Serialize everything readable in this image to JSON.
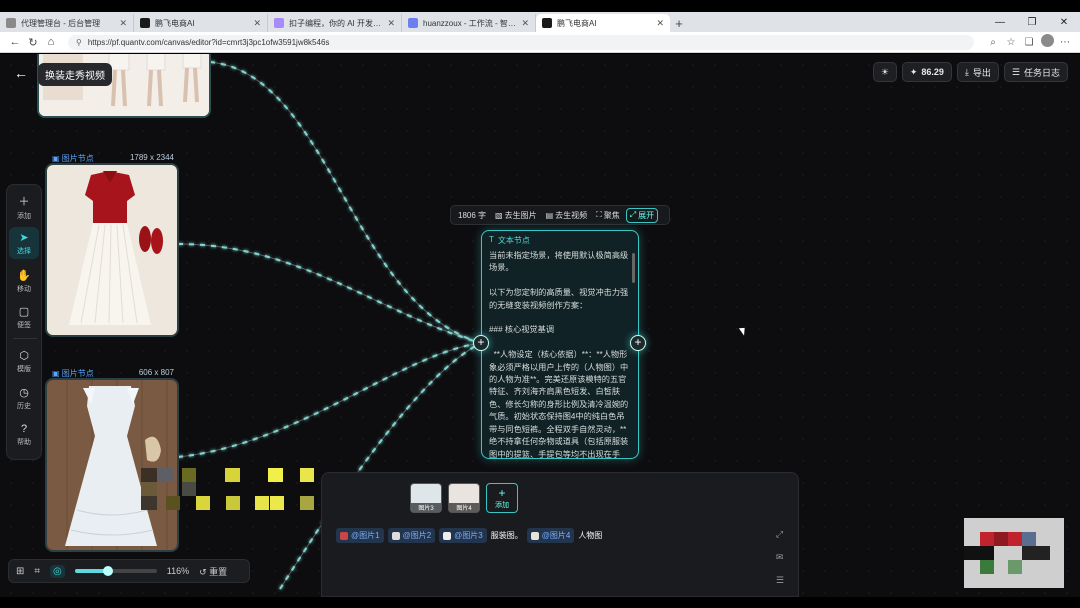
{
  "browser": {
    "tabs": [
      {
        "title": "代理管理台 - 后台管理",
        "fav": "#8a8a8a"
      },
      {
        "title": "鹏飞电商AI",
        "fav": "#1a1a1a"
      },
      {
        "title": "扣子编程，你的 AI 开发伙伴，Vi",
        "fav": "#a78bfa"
      },
      {
        "title": "huanzzoux - 工作流 - 智能体平台",
        "fav": "#6d7ff0"
      },
      {
        "title": "鹏飞电商AI",
        "fav": "#1a1a1a",
        "active": true
      }
    ],
    "url": "https://pf.quantv.com/canvas/editor?id=cmrt3j3pc1ofw3591jw8k546s"
  },
  "header": {
    "title": "换装走秀视频",
    "credits": "86.29",
    "export_label": "导出",
    "tasklog_label": "任务日志"
  },
  "toolbar": {
    "items": [
      {
        "icon": "plus-icon",
        "label": "添加"
      },
      {
        "icon": "cursor-icon",
        "label": "选择",
        "selected": true
      },
      {
        "icon": "hand-icon",
        "label": "移动"
      },
      {
        "icon": "note-icon",
        "label": "便签"
      },
      {
        "icon": "box-icon",
        "label": "模版"
      },
      {
        "icon": "clock-icon",
        "label": "历史"
      },
      {
        "icon": "help-icon",
        "label": "帮助"
      }
    ]
  },
  "image_nodes": [
    {
      "label": "图片节点",
      "size": "1789 x 2344"
    },
    {
      "label": "图片节点",
      "size": "606 x 807"
    }
  ],
  "text_node": {
    "title": "文本节点",
    "word_count": "1806 字",
    "actions": [
      "去生图片",
      "去生视频",
      "聚焦",
      "展开"
    ],
    "content": "当前未指定场景，将使用默认极简高级场景。\n\n以下为您定制的高质量、视觉冲击力强的无缝变装视频创作方案：\n\n### 核心视觉基调\n\n  **人物设定（核心依据）**：**人物形象必须严格以用户上传的（人物图）中的人物为准**。完美还原该模特的五官特征、齐刘海齐肩黑色短发、白皙肤色、修长匀称的身形比例及清冷温婉的气质。初始状态保持图4中的纯白色吊带与同色短裤。全程双手自然灵动，**绝不持拿任何杂物或道具（包括原服装图中的提篮、手提包等均不出现在手中）**。动作松"
  },
  "prompt_panel": {
    "thumbs": [
      {
        "label": "图片3"
      },
      {
        "label": "图片4"
      }
    ],
    "add_label": "添加",
    "mentions": [
      "@图片1",
      "@图片2",
      "@图片3"
    ],
    "text1": "服装图。",
    "mention4": "@图片4",
    "text2": "人物图"
  },
  "zoom": {
    "percent": "116%",
    "reset_label": "重置",
    "level": 0.4
  }
}
